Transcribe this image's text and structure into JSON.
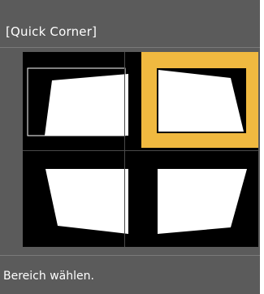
{
  "title": "[Quick Corner]",
  "status_text": "Bereich wählen.",
  "selected_index": 1,
  "colors": {
    "panel": "#5b5b5b",
    "selection": "#f0b940",
    "shape": "#ffffff",
    "frame": "#000000"
  },
  "options": [
    {
      "name": "top-left"
    },
    {
      "name": "top-right"
    },
    {
      "name": "bottom-left"
    },
    {
      "name": "bottom-right"
    }
  ]
}
